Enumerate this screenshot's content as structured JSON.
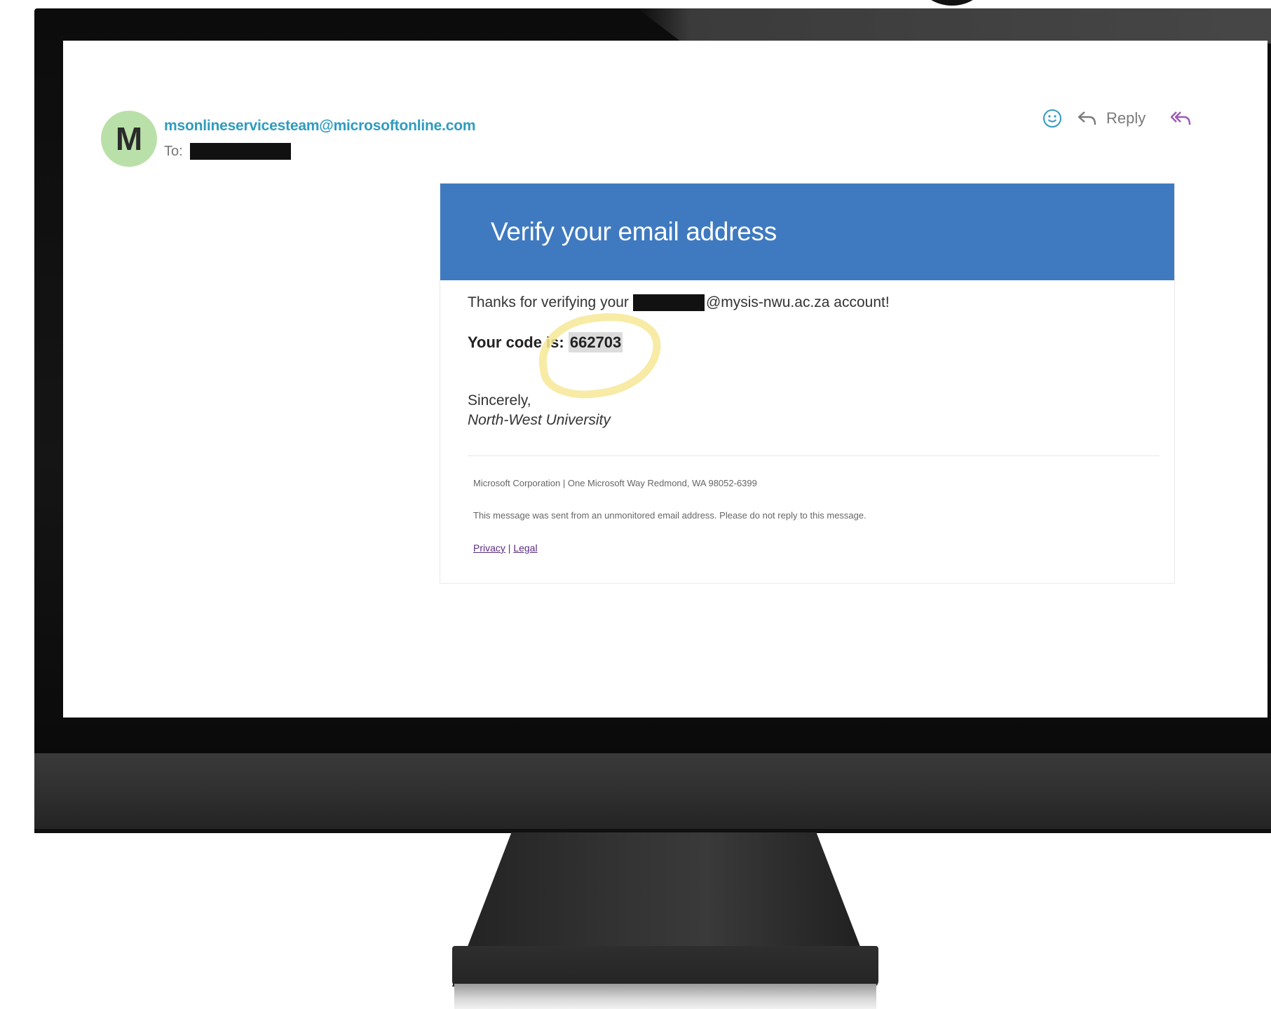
{
  "email": {
    "avatar_letter": "M",
    "sender": "msonlineservicesteam@microsoftonline.com",
    "to_label": "To:",
    "actions": {
      "emoji_icon": "smiley-icon",
      "reply_icon": "reply-arrow-icon",
      "reply_label": "Reply",
      "reply_all_icon": "reply-all-arrow-icon"
    }
  },
  "message": {
    "banner_title": "Verify your email address",
    "body_prefix": "Thanks for verifying your",
    "body_suffix": "@mysis-nwu.ac.za account!",
    "code_label": "Your code is:",
    "code_value": "662703",
    "closing": "Sincerely,",
    "signature": "North-West University",
    "footer_address": "Microsoft Corporation | One Microsoft Way Redmond, WA 98052-6399",
    "footer_notice": "This message was sent from an unmonitored email address. Please do not reply to this message.",
    "link_privacy": "Privacy",
    "link_separator": "|",
    "link_legal": "Legal"
  },
  "colors": {
    "banner": "#3f7ac0",
    "sender": "#2f9bbf",
    "avatar": "#b9e0a8",
    "highlight": "#f6e896",
    "link": "#5a2d82"
  }
}
